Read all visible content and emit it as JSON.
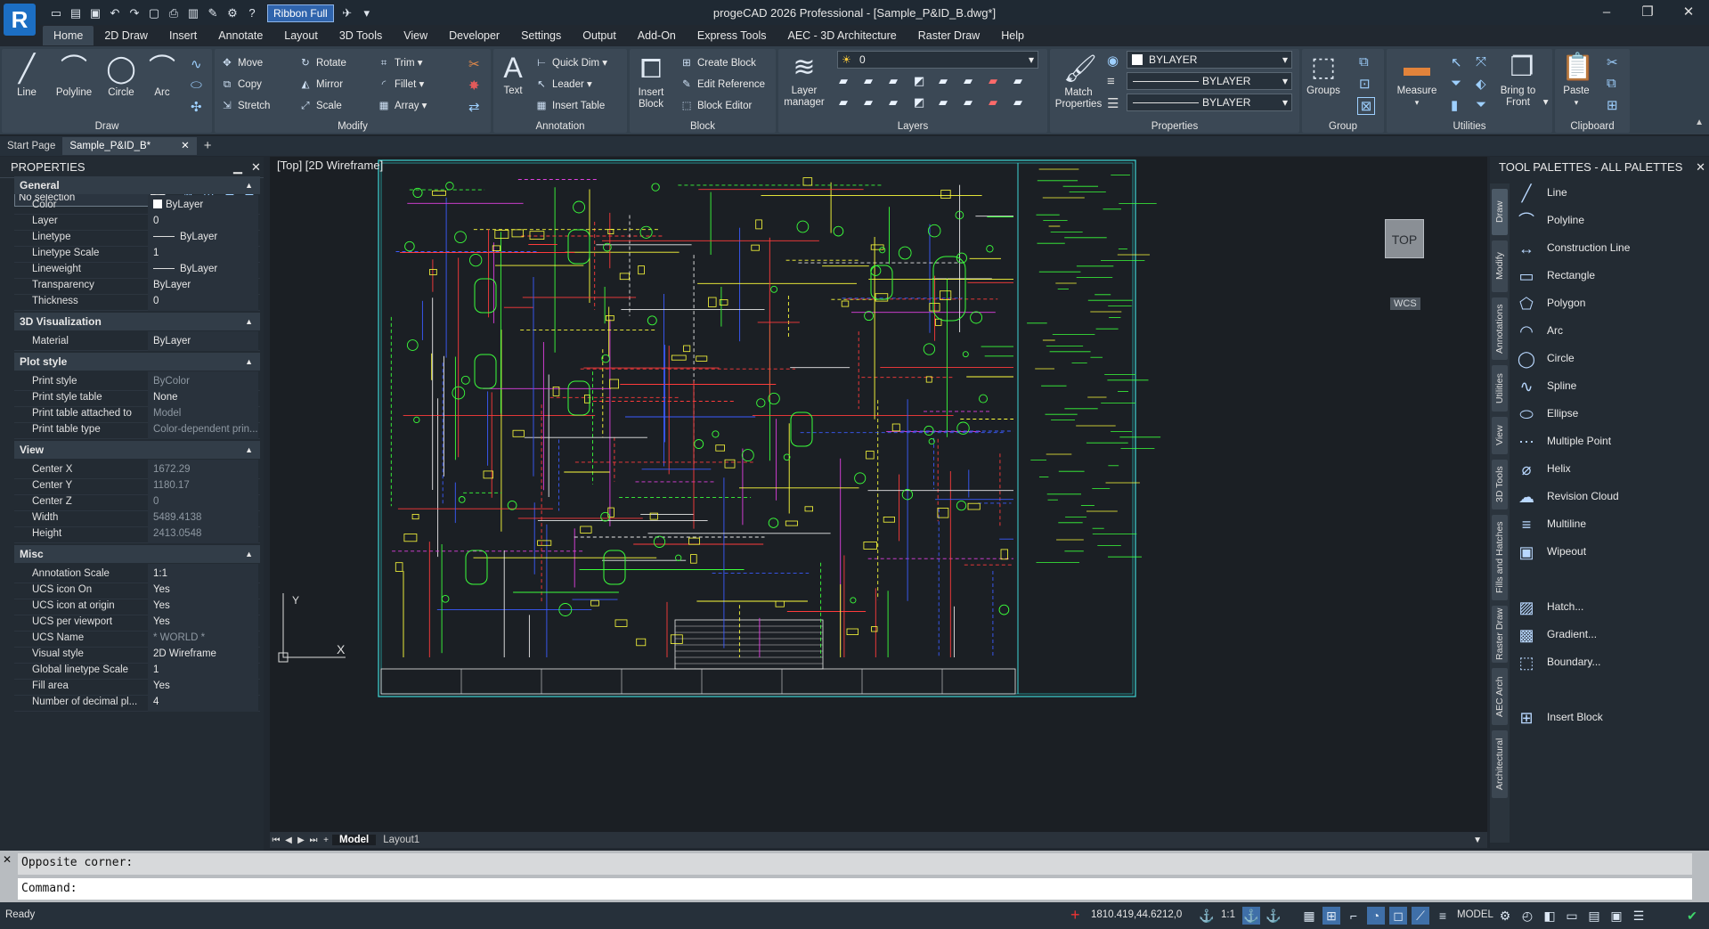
{
  "app": {
    "title": "progeCAD 2026 Professional - [Sample_P&ID_B.dwg*]",
    "logo_letter": "R",
    "ribbon_mode": "Ribbon Full",
    "window_controls": [
      "–",
      "❐",
      "✕"
    ]
  },
  "tabs": [
    "Home",
    "2D Draw",
    "Insert",
    "Annotate",
    "Layout",
    "3D Tools",
    "View",
    "Developer",
    "Settings",
    "Output",
    "Add-On",
    "Express Tools",
    "AEC - 3D Architecture",
    "Raster Draw",
    "Help"
  ],
  "ribbon": {
    "draw": {
      "title": "Draw",
      "line": "Line",
      "polyline": "Polyline",
      "circle": "Circle",
      "arc": "Arc"
    },
    "modify": {
      "title": "Modify",
      "move": "Move",
      "rotate": "Rotate",
      "trim": "Trim",
      "copy": "Copy",
      "mirror": "Mirror",
      "fillet": "Fillet",
      "stretch": "Stretch",
      "scale": "Scale",
      "array": "Array"
    },
    "annotation": {
      "title": "Annotation",
      "text": "Text",
      "quick_dim": "Quick Dim",
      "leader": "Leader",
      "insert_table": "Insert Table"
    },
    "block": {
      "title": "Block",
      "insert_block": "Insert Block",
      "create_block": "Create Block",
      "edit_reference": "Edit Reference",
      "block_editor": "Block Editor"
    },
    "layers": {
      "title": "Layers",
      "layer_manager": "Layer manager",
      "current_layer": "0"
    },
    "properties": {
      "title": "Properties",
      "match": "Match Properties",
      "color": "BYLAYER",
      "linetype": "BYLAYER",
      "lineweight": "BYLAYER"
    },
    "groups": {
      "title": "Group",
      "groups": "Groups"
    },
    "utilities": {
      "title": "Utilities",
      "measure": "Measure",
      "bring_to_front": "Bring to Front"
    },
    "clipboard": {
      "title": "Clipboard",
      "paste": "Paste"
    }
  },
  "doc_tabs": {
    "start": "Start Page",
    "active": "Sample_P&ID_B*",
    "close": "✕",
    "add": "+"
  },
  "properties": {
    "title": "PROPERTIES",
    "selection": "No selection",
    "sections": [
      {
        "name": "General",
        "rows": [
          [
            "Color",
            "ByLayer"
          ],
          [
            "Layer",
            "0"
          ],
          [
            "Linetype",
            "ByLayer"
          ],
          [
            "Linetype Scale",
            "1"
          ],
          [
            "Lineweight",
            "ByLayer"
          ],
          [
            "Transparency",
            "ByLayer"
          ],
          [
            "Thickness",
            "0"
          ]
        ]
      },
      {
        "name": "3D Visualization",
        "rows": [
          [
            "Material",
            "ByLayer"
          ]
        ]
      },
      {
        "name": "Plot style",
        "rows": [
          [
            "Print style",
            "ByColor"
          ],
          [
            "Print style table",
            "None"
          ],
          [
            "Print table attached to",
            "Model"
          ],
          [
            "Print table type",
            "Color-dependent prin..."
          ]
        ]
      },
      {
        "name": "View",
        "rows": [
          [
            "Center X",
            "1672.29"
          ],
          [
            "Center Y",
            "1180.17"
          ],
          [
            "Center Z",
            "0"
          ],
          [
            "Width",
            "5489.4138"
          ],
          [
            "Height",
            "2413.0548"
          ]
        ]
      },
      {
        "name": "Misc",
        "rows": [
          [
            "Annotation Scale",
            "1:1"
          ],
          [
            "UCS icon On",
            "Yes"
          ],
          [
            "UCS icon at origin",
            "Yes"
          ],
          [
            "UCS per viewport",
            "Yes"
          ],
          [
            "UCS Name",
            "* WORLD *"
          ],
          [
            "Visual style",
            "2D Wireframe"
          ],
          [
            "Global linetype Scale",
            "1"
          ],
          [
            "Fill area",
            "Yes"
          ],
          [
            "Number of decimal pl...",
            "4"
          ]
        ]
      }
    ]
  },
  "viewport": {
    "label": "[Top]  [2D Wireframe]",
    "cube": "TOP",
    "wcs": "WCS",
    "axis_x": "X",
    "axis_y": "Y"
  },
  "model_tabs": {
    "model": "Model",
    "layout1": "Layout1"
  },
  "palette": {
    "title": "TOOL PALETTES - ALL PALETTES",
    "vtabs": [
      "Draw",
      "Modify",
      "Annotations",
      "Utilities",
      "View",
      "3D Tools",
      "Fills and Hatches",
      "Raster Draw",
      "AEC Arch",
      "Architectural"
    ],
    "items": [
      "Line",
      "Polyline",
      "Construction Line",
      "Rectangle",
      "Polygon",
      "Arc",
      "Circle",
      "Spline",
      "Ellipse",
      "Multiple Point",
      "Helix",
      "Revision Cloud",
      "Multiline",
      "Wipeout",
      "Hatch...",
      "Gradient...",
      "Boundary...",
      "Insert Block"
    ]
  },
  "command": {
    "history": "Opposite corner:",
    "prompt": "Command:"
  },
  "status": {
    "ready": "Ready",
    "coords": "1810.419,44.6212,0",
    "scale": "1:1",
    "space": "MODEL"
  }
}
